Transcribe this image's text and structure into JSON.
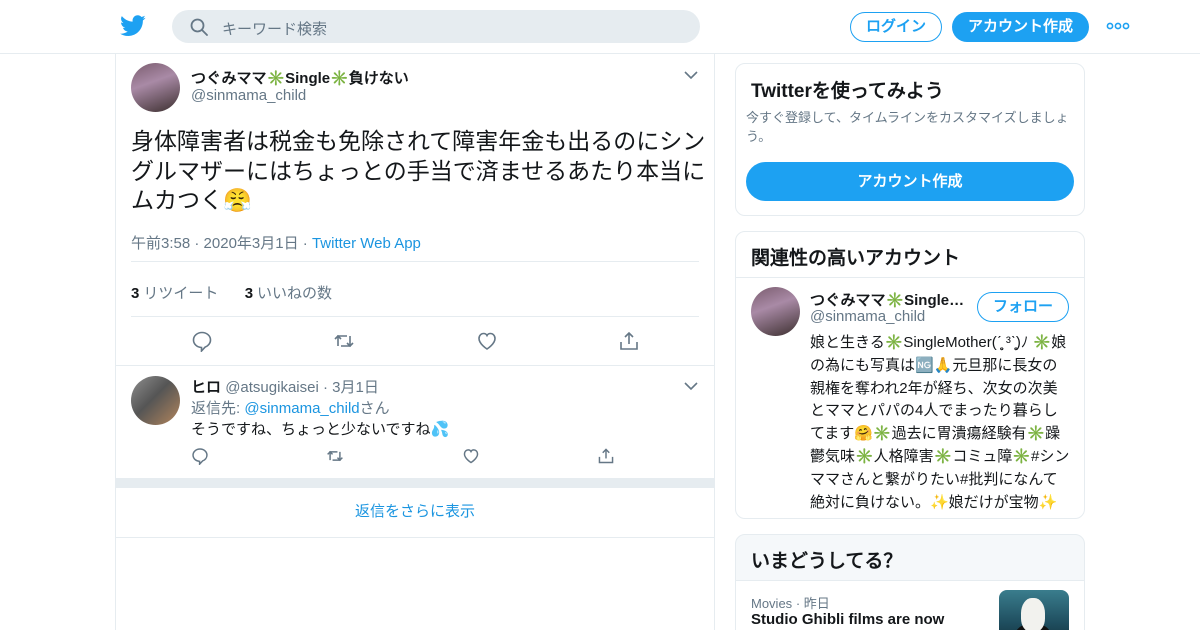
{
  "header": {
    "logo_icon": "twitter-bird-icon",
    "search_placeholder": "キーワード検索",
    "login_label": "ログイン",
    "signup_label": "アカウント作成",
    "more_icon": "more-dots-icon",
    "accent_color": "#1da1f2"
  },
  "tweet": {
    "display_name": "つぐみママ✳️Single✳️負けない",
    "handle": "@sinmama_child",
    "text": "身体障害者は税金も免除されて障害年金も出るのにシングルマザーにはちょっとの手当で済ませるあたり本当にムカつく😤",
    "time": "午前3:58",
    "date": "2020年3月1日",
    "source": "Twitter Web App",
    "retweet_count": "3",
    "retweet_label": "リツイート",
    "like_count": "3",
    "like_label": "いいねの数"
  },
  "reply": {
    "display_name": "ヒロ",
    "handle": "@atsugikaisei",
    "date": "3月1日",
    "reply_to_prefix": "返信先: ",
    "reply_to_handle": "@sinmama_child",
    "reply_to_suffix": "さん",
    "text": "そうですね、ちょっと少ないですね💦"
  },
  "show_more_replies": "返信をさらに表示",
  "sidebar": {
    "signup_card": {
      "title": "Twitterを使ってみよう",
      "description": "今すぐ登録して、タイムラインをカスタマイズしましょう。",
      "button": "アカウント作成"
    },
    "related_card": {
      "title": "関連性の高いアカウント",
      "display_name": "つぐみママ✳️Single✳️負けない",
      "handle": "@sinmama_child",
      "follow_label": "フォロー",
      "bio": "娘と生きる✳️SingleMother(ˊ̥̥̥̥̥ ³ˋ̥̥̥̥̥)ﾉ ✳️娘の為にも写真は🆖🙏元旦那に長女の親権を奪われ2年が経ち、次女の次美とママとパパの4人でまったり暮らしてます🤗✳️過去に胃潰瘍経験有✳️躁鬱気味✳️人格障害✳️コミュ障✳️#シンママさんと繋がりたい#批判になんて絶対に負けない。✨娘だけが宝物✨"
    },
    "trends_card": {
      "title": "いまどうしてる？",
      "category": "Movies",
      "time": "昨日",
      "headline": "Studio Ghibli films are now"
    }
  }
}
